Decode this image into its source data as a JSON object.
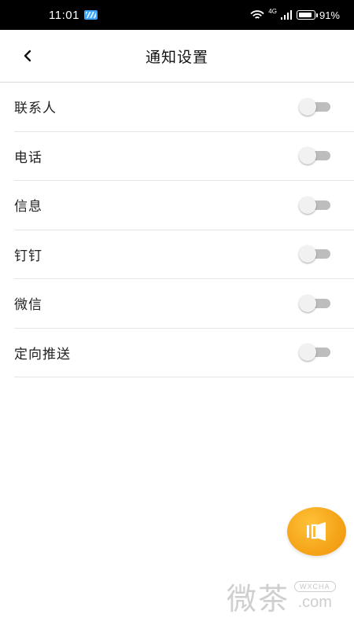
{
  "status_bar": {
    "time": "11:01",
    "network": "4G",
    "battery_percent": "91%",
    "battery_level": 0.91
  },
  "header": {
    "title": "通知设置",
    "back_icon": "chevron-left-icon"
  },
  "settings": [
    {
      "label": "联系人",
      "enabled": false
    },
    {
      "label": "电话",
      "enabled": false
    },
    {
      "label": "信息",
      "enabled": false
    },
    {
      "label": "钉钉",
      "enabled": false
    },
    {
      "label": "微信",
      "enabled": false
    },
    {
      "label": "定向推送",
      "enabled": false
    }
  ],
  "floating_button": {
    "icon": "speaker-icon",
    "color": "#f5a418"
  },
  "watermark": {
    "chars": "微茶",
    "badge": "WXCHA",
    "suffix": ".com"
  }
}
